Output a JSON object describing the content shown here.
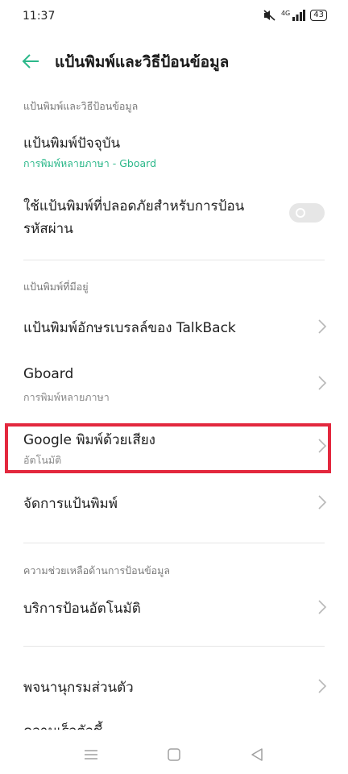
{
  "status": {
    "time": "11:37",
    "network": "4G",
    "battery": "43"
  },
  "header": {
    "title": "แป้นพิมพ์และวิธีป้อนข้อมูล"
  },
  "sections": {
    "input_method": "แป้นพิมพ์และวิธีป้อนข้อมูล",
    "available_keyboards": "แป้นพิมพ์ที่มีอยู่",
    "input_assistance": "ความช่วยเหลือด้านการป้อนข้อมูล"
  },
  "items": {
    "current_keyboard": {
      "title": "แป้นพิมพ์ปัจจุบัน",
      "subtitle": "การพิมพ์หลายภาษา - Gboard"
    },
    "secure_keyboard": {
      "title_line1": "ใช้แป้นพิมพ์ที่ปลอดภัยสำหรับการป้อน",
      "title_line2": "รหัสผ่าน",
      "enabled": false
    },
    "talkback_braille": {
      "title": "แป้นพิมพ์อักษรเบรลล์ของ TalkBack"
    },
    "gboard": {
      "title": "Gboard",
      "subtitle": "การพิมพ์หลายภาษา"
    },
    "google_voice": {
      "title": "Google พิมพ์ด้วยเสียง",
      "subtitle": "อัตโนมัติ"
    },
    "manage_keyboards": {
      "title": "จัดการแป้นพิมพ์"
    },
    "autofill": {
      "title": "บริการป้อนอัตโนมัติ"
    },
    "personal_dictionary": {
      "title": "พจนานุกรมส่วนตัว"
    },
    "partial_next": {
      "title": "ความเร็วตัวชี้"
    }
  },
  "colors": {
    "accent": "#2cb88a",
    "highlight": "#e3283e",
    "text": "#1f1f1f",
    "secondary": "#7a7a7a"
  },
  "icons": {
    "back": "arrow-left-icon",
    "chevron": "chevron-right-icon",
    "nav_menu": "menu-icon",
    "nav_home": "square-icon",
    "nav_back": "triangle-back-icon"
  }
}
